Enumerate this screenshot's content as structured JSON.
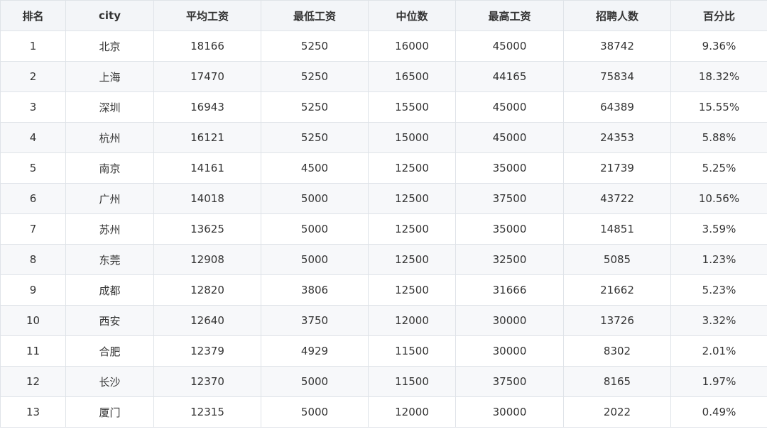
{
  "table": {
    "headers": [
      "排名",
      "city",
      "平均工资",
      "最低工资",
      "中位数",
      "最高工资",
      "招聘人数",
      "百分比"
    ],
    "rows": [
      [
        "1",
        "北京",
        "18166",
        "5250",
        "16000",
        "45000",
        "38742",
        "9.36%"
      ],
      [
        "2",
        "上海",
        "17470",
        "5250",
        "16500",
        "44165",
        "75834",
        "18.32%"
      ],
      [
        "3",
        "深圳",
        "16943",
        "5250",
        "15500",
        "45000",
        "64389",
        "15.55%"
      ],
      [
        "4",
        "杭州",
        "16121",
        "5250",
        "15000",
        "45000",
        "24353",
        "5.88%"
      ],
      [
        "5",
        "南京",
        "14161",
        "4500",
        "12500",
        "35000",
        "21739",
        "5.25%"
      ],
      [
        "6",
        "广州",
        "14018",
        "5000",
        "12500",
        "37500",
        "43722",
        "10.56%"
      ],
      [
        "7",
        "苏州",
        "13625",
        "5000",
        "12500",
        "35000",
        "14851",
        "3.59%"
      ],
      [
        "8",
        "东莞",
        "12908",
        "5000",
        "12500",
        "32500",
        "5085",
        "1.23%"
      ],
      [
        "9",
        "成都",
        "12820",
        "3806",
        "12500",
        "31666",
        "21662",
        "5.23%"
      ],
      [
        "10",
        "西安",
        "12640",
        "3750",
        "12000",
        "30000",
        "13726",
        "3.32%"
      ],
      [
        "11",
        "合肥",
        "12379",
        "4929",
        "11500",
        "30000",
        "8302",
        "2.01%"
      ],
      [
        "12",
        "长沙",
        "12370",
        "5000",
        "11500",
        "37500",
        "8165",
        "1.97%"
      ],
      [
        "13",
        "厦门",
        "12315",
        "5000",
        "12000",
        "30000",
        "2022",
        "0.49%"
      ]
    ]
  }
}
